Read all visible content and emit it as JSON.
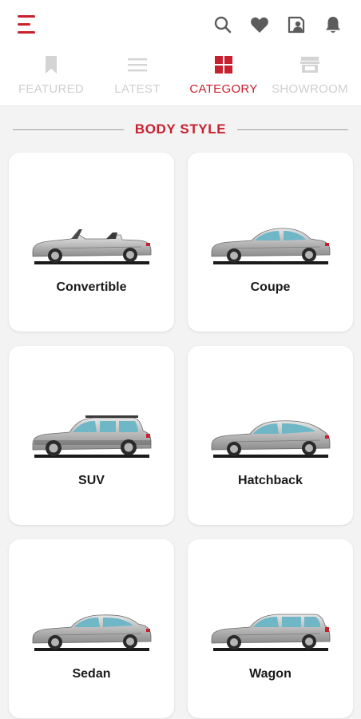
{
  "colors": {
    "accent": "#c8202f",
    "icon_dark": "#5c5c5c",
    "tab_inactive": "#cfcfcf",
    "background": "#f3f3f3",
    "card": "#ffffff"
  },
  "header": {
    "menu_icon": "hamburger-icon",
    "actions": [
      {
        "icon": "search-icon"
      },
      {
        "icon": "heart-icon"
      },
      {
        "icon": "dealer-card-icon"
      },
      {
        "icon": "bell-icon"
      }
    ]
  },
  "tabs": [
    {
      "label": "FEATURED",
      "icon": "bookmark-icon",
      "active": false
    },
    {
      "label": "LATEST",
      "icon": "list-icon",
      "active": false
    },
    {
      "label": "CATEGORY",
      "icon": "grid-icon",
      "active": true
    },
    {
      "label": "SHOWROOM",
      "icon": "store-icon",
      "active": false
    }
  ],
  "section": {
    "title": "BODY STYLE"
  },
  "categories": [
    {
      "label": "Convertible",
      "icon": "convertible-car-icon"
    },
    {
      "label": "Coupe",
      "icon": "coupe-car-icon"
    },
    {
      "label": "SUV",
      "icon": "suv-car-icon"
    },
    {
      "label": "Hatchback",
      "icon": "hatchback-car-icon"
    },
    {
      "label": "Sedan",
      "icon": "sedan-car-icon"
    },
    {
      "label": "Wagon",
      "icon": "wagon-car-icon"
    }
  ]
}
